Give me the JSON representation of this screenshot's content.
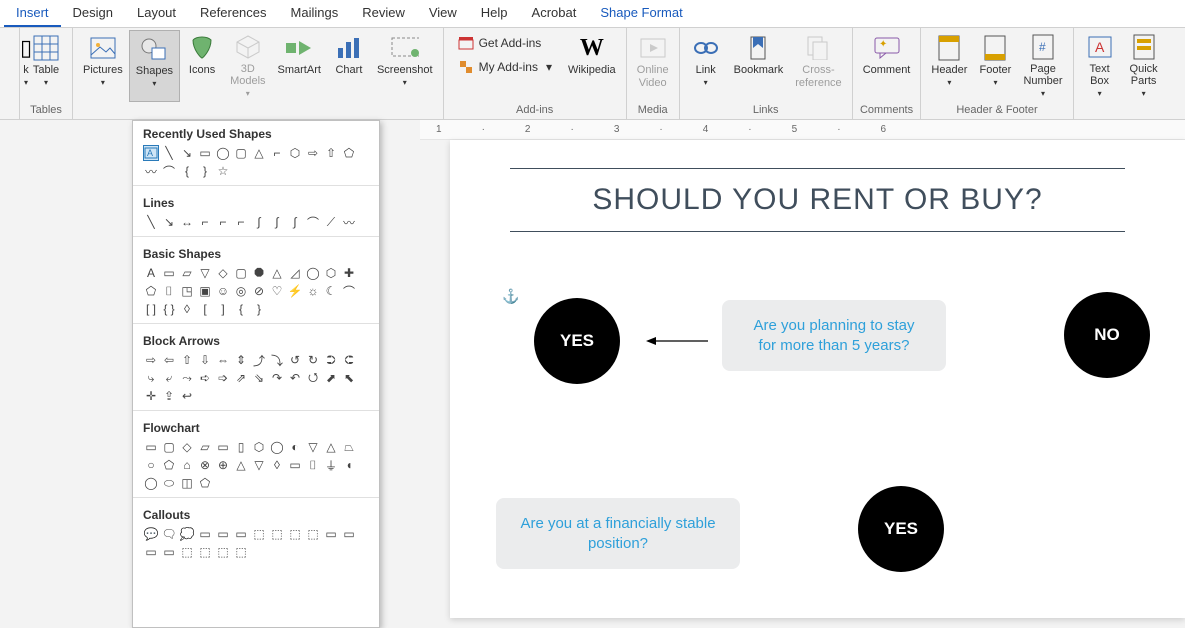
{
  "tabs": {
    "insert": "Insert",
    "design": "Design",
    "layout": "Layout",
    "references": "References",
    "mailings": "Mailings",
    "review": "Review",
    "view": "View",
    "help": "Help",
    "acrobat": "Acrobat",
    "shape_format": "Shape Format"
  },
  "ribbon": {
    "tables": {
      "table": "Table",
      "group": "Tables"
    },
    "illustrations": {
      "pictures": "Pictures",
      "shapes": "Shapes",
      "icons": "Icons",
      "models": "3D\nModels",
      "smartart": "SmartArt",
      "chart": "Chart",
      "screenshot": "Screenshot"
    },
    "addins": {
      "get": "Get Add-ins",
      "my": "My Add-ins",
      "wikipedia": "Wikipedia",
      "group": "Add-ins"
    },
    "media": {
      "video": "Online\nVideo",
      "group": "Media"
    },
    "links": {
      "link": "Link",
      "bookmark": "Bookmark",
      "crossref": "Cross-\nreference",
      "group": "Links"
    },
    "comments": {
      "comment": "Comment",
      "group": "Comments"
    },
    "headerfooter": {
      "header": "Header",
      "footer": "Footer",
      "pagenum": "Page\nNumber",
      "group": "Header & Footer"
    },
    "text": {
      "textbox": "Text\nBox",
      "quickparts": "Quick\nParts"
    }
  },
  "shapes_panel": {
    "recently": "Recently Used Shapes",
    "lines": "Lines",
    "basic": "Basic Shapes",
    "block": "Block Arrows",
    "flowchart": "Flowchart",
    "callouts": "Callouts"
  },
  "ruler": {
    "m1": "1",
    "m2": "2",
    "m3": "3",
    "m4": "4",
    "m5": "5",
    "m6": "6"
  },
  "document": {
    "title": "SHOULD YOU RENT OR BUY?",
    "q1": "Are you planning to stay for more than 5 years?",
    "q2": "Are you at a financially stable position?",
    "yes": "YES",
    "no": "NO"
  },
  "colors": {
    "accent": "#2ea0da",
    "heading": "#404e5c"
  }
}
